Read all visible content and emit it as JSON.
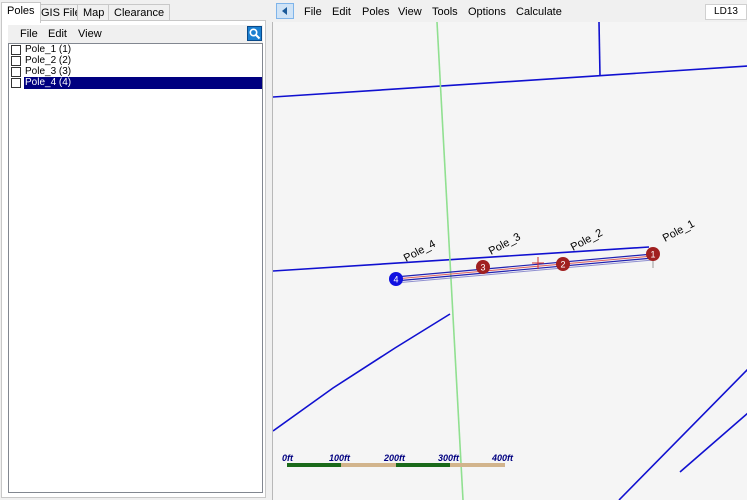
{
  "left_tabs": [
    "Poles",
    "GIS Files",
    "Map",
    "Clearance"
  ],
  "inner_menu": [
    "File",
    "Edit",
    "View"
  ],
  "pole_list": [
    {
      "label": "Pole_1  (1)",
      "selected": false
    },
    {
      "label": "Pole_2  (2)",
      "selected": false
    },
    {
      "label": "Pole_3  (3)",
      "selected": false
    },
    {
      "label": "Pole_4  (4)",
      "selected": true
    }
  ],
  "main_menu": [
    "File",
    "Edit",
    "Poles",
    "View",
    "Tools",
    "Options",
    "Calculate"
  ],
  "mode_label": "LD13",
  "map": {
    "poles": [
      {
        "number": "1",
        "name": "Pole_1",
        "color": "#a02020"
      },
      {
        "number": "2",
        "name": "Pole_2",
        "color": "#a02020"
      },
      {
        "number": "3",
        "name": "Pole_3",
        "color": "#a02020"
      },
      {
        "number": "4",
        "name": "Pole_4",
        "color": "#1010e0"
      }
    ],
    "scale_labels": [
      "0ft",
      "100ft",
      "200ft",
      "300ft",
      "400ft"
    ],
    "colors": {
      "boundary": "#1010d0",
      "centerline": "#90e090",
      "span": "#2020b0",
      "scale_dark": "#1a6a1a",
      "scale_light": "#d2b48c"
    }
  }
}
